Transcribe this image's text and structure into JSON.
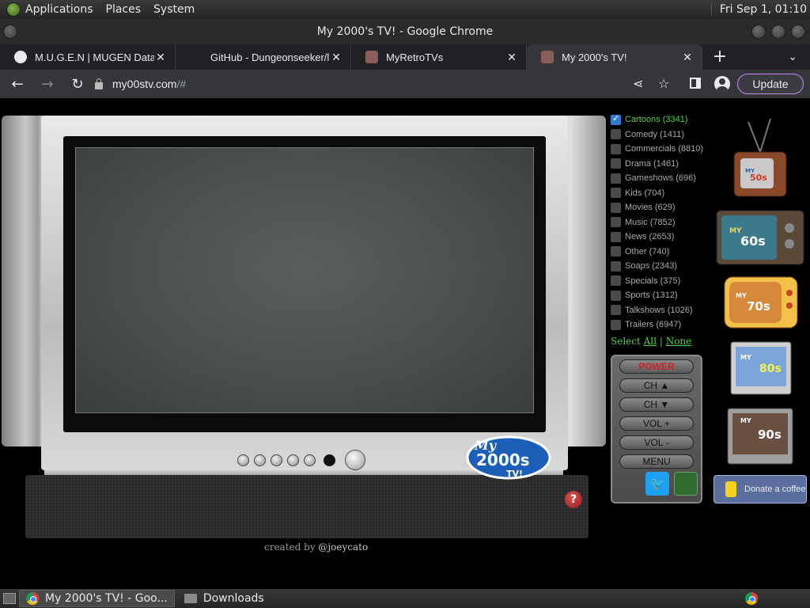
{
  "system_panel": {
    "menus": [
      "Applications",
      "Places",
      "System"
    ],
    "clock": "Fri Sep  1, 01:10"
  },
  "window": {
    "title": "My 2000's TV! - Google Chrome"
  },
  "tabs": [
    {
      "label": "M.U.G.E.N | MUGEN Databa",
      "favicon": "globe-icon"
    },
    {
      "label": "GitHub - Dungeonseeker/lin",
      "favicon": "github-icon"
    },
    {
      "label": "MyRetroTVs",
      "favicon": "tv-favicon"
    },
    {
      "label": "My 2000's TV!",
      "favicon": "tv-favicon",
      "active": true
    }
  ],
  "toolbar": {
    "url_host": "my00stv.com",
    "url_path": "/#",
    "update_label": "Update"
  },
  "categories": [
    {
      "label": "Cartoons (3341)",
      "checked": true
    },
    {
      "label": "Comedy (1411)",
      "checked": false
    },
    {
      "label": "Commercials (8810)",
      "checked": false
    },
    {
      "label": "Drama (1461)",
      "checked": false
    },
    {
      "label": "Gameshows (696)",
      "checked": false
    },
    {
      "label": "Kids (704)",
      "checked": false
    },
    {
      "label": "Movies (629)",
      "checked": false
    },
    {
      "label": "Music (7852)",
      "checked": false
    },
    {
      "label": "News (2653)",
      "checked": false
    },
    {
      "label": "Other (740)",
      "checked": false
    },
    {
      "label": "Soaps (2343)",
      "checked": false
    },
    {
      "label": "Specials (375)",
      "checked": false
    },
    {
      "label": "Sports (1312)",
      "checked": false
    },
    {
      "label": "Talkshows (1026)",
      "checked": false
    },
    {
      "label": "Trailers (6947)",
      "checked": false
    }
  ],
  "select": {
    "prefix": "Select",
    "all": "All",
    "sep": "|",
    "none": "None"
  },
  "remote": {
    "power": "POWER",
    "ch_up": "CH ▲",
    "ch_down": "CH ▼",
    "vol_up": "VOL +",
    "vol_down": "VOL -",
    "menu": "MENU"
  },
  "decades": [
    {
      "label": "MY 50s TV!",
      "decade": "50s"
    },
    {
      "label": "MY 60s TV!",
      "decade": "60s"
    },
    {
      "label": "MY 70s TV!",
      "decade": "70s"
    },
    {
      "label": "MY 80s TV!",
      "decade": "80s"
    },
    {
      "label": "MY 90s TV!",
      "decade": "90s"
    }
  ],
  "donate": {
    "label": "Donate a coffee"
  },
  "tv": {
    "brand_my": "My",
    "brand_decade": "2000s",
    "brand_tv": "TV!"
  },
  "credit": {
    "prefix": "created by",
    "handle": "@joeycato"
  },
  "taskbar": {
    "items": [
      "My 2000's TV! - Goo...",
      "Downloads"
    ]
  },
  "colors": {
    "accent_green": "#4fd14f",
    "update_border": "#c58af9",
    "power_red": "#d42020",
    "twitter_blue": "#1da1f2"
  }
}
